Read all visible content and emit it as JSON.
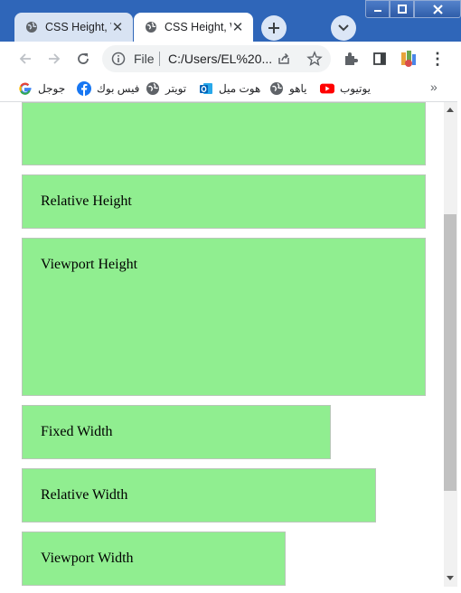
{
  "browser": {
    "tabs": [
      {
        "label": "CSS Height, Width",
        "close": "✕",
        "active": false
      },
      {
        "label": "CSS Height, Width",
        "close": "✕",
        "active": true
      }
    ],
    "new_tab": "+",
    "tab_search": "⌄",
    "window_controls": {
      "minimize": "—",
      "maximize": "□",
      "close": "✕"
    },
    "toolbar": {
      "back": "←",
      "forward": "→",
      "reload": "↻",
      "url_scheme": "File",
      "url": "C:/Users/EL%20...",
      "menu": "⋮"
    },
    "bookmarks": [
      {
        "label": "جوجل",
        "icon": "google-icon"
      },
      {
        "label": "فيس بوك",
        "icon": "facebook-icon"
      },
      {
        "label": "تويتر",
        "icon": "globe-icon"
      },
      {
        "label": "هوت ميل",
        "icon": "outlook-icon"
      },
      {
        "label": "ياهو",
        "icon": "globe-icon"
      },
      {
        "label": "يوتيوب",
        "icon": "youtube-icon"
      }
    ],
    "bookmarks_more": "»"
  },
  "page": {
    "boxes": [
      {
        "label": ""
      },
      {
        "label": "Relative Height"
      },
      {
        "label": "Viewport Height"
      },
      {
        "label": "Fixed Width"
      },
      {
        "label": "Relative Width"
      },
      {
        "label": "Viewport Width"
      }
    ]
  },
  "colors": {
    "title_bar": "#2f66b9",
    "box_fill": "#90ee90",
    "box_border": "#b9c7b9"
  }
}
